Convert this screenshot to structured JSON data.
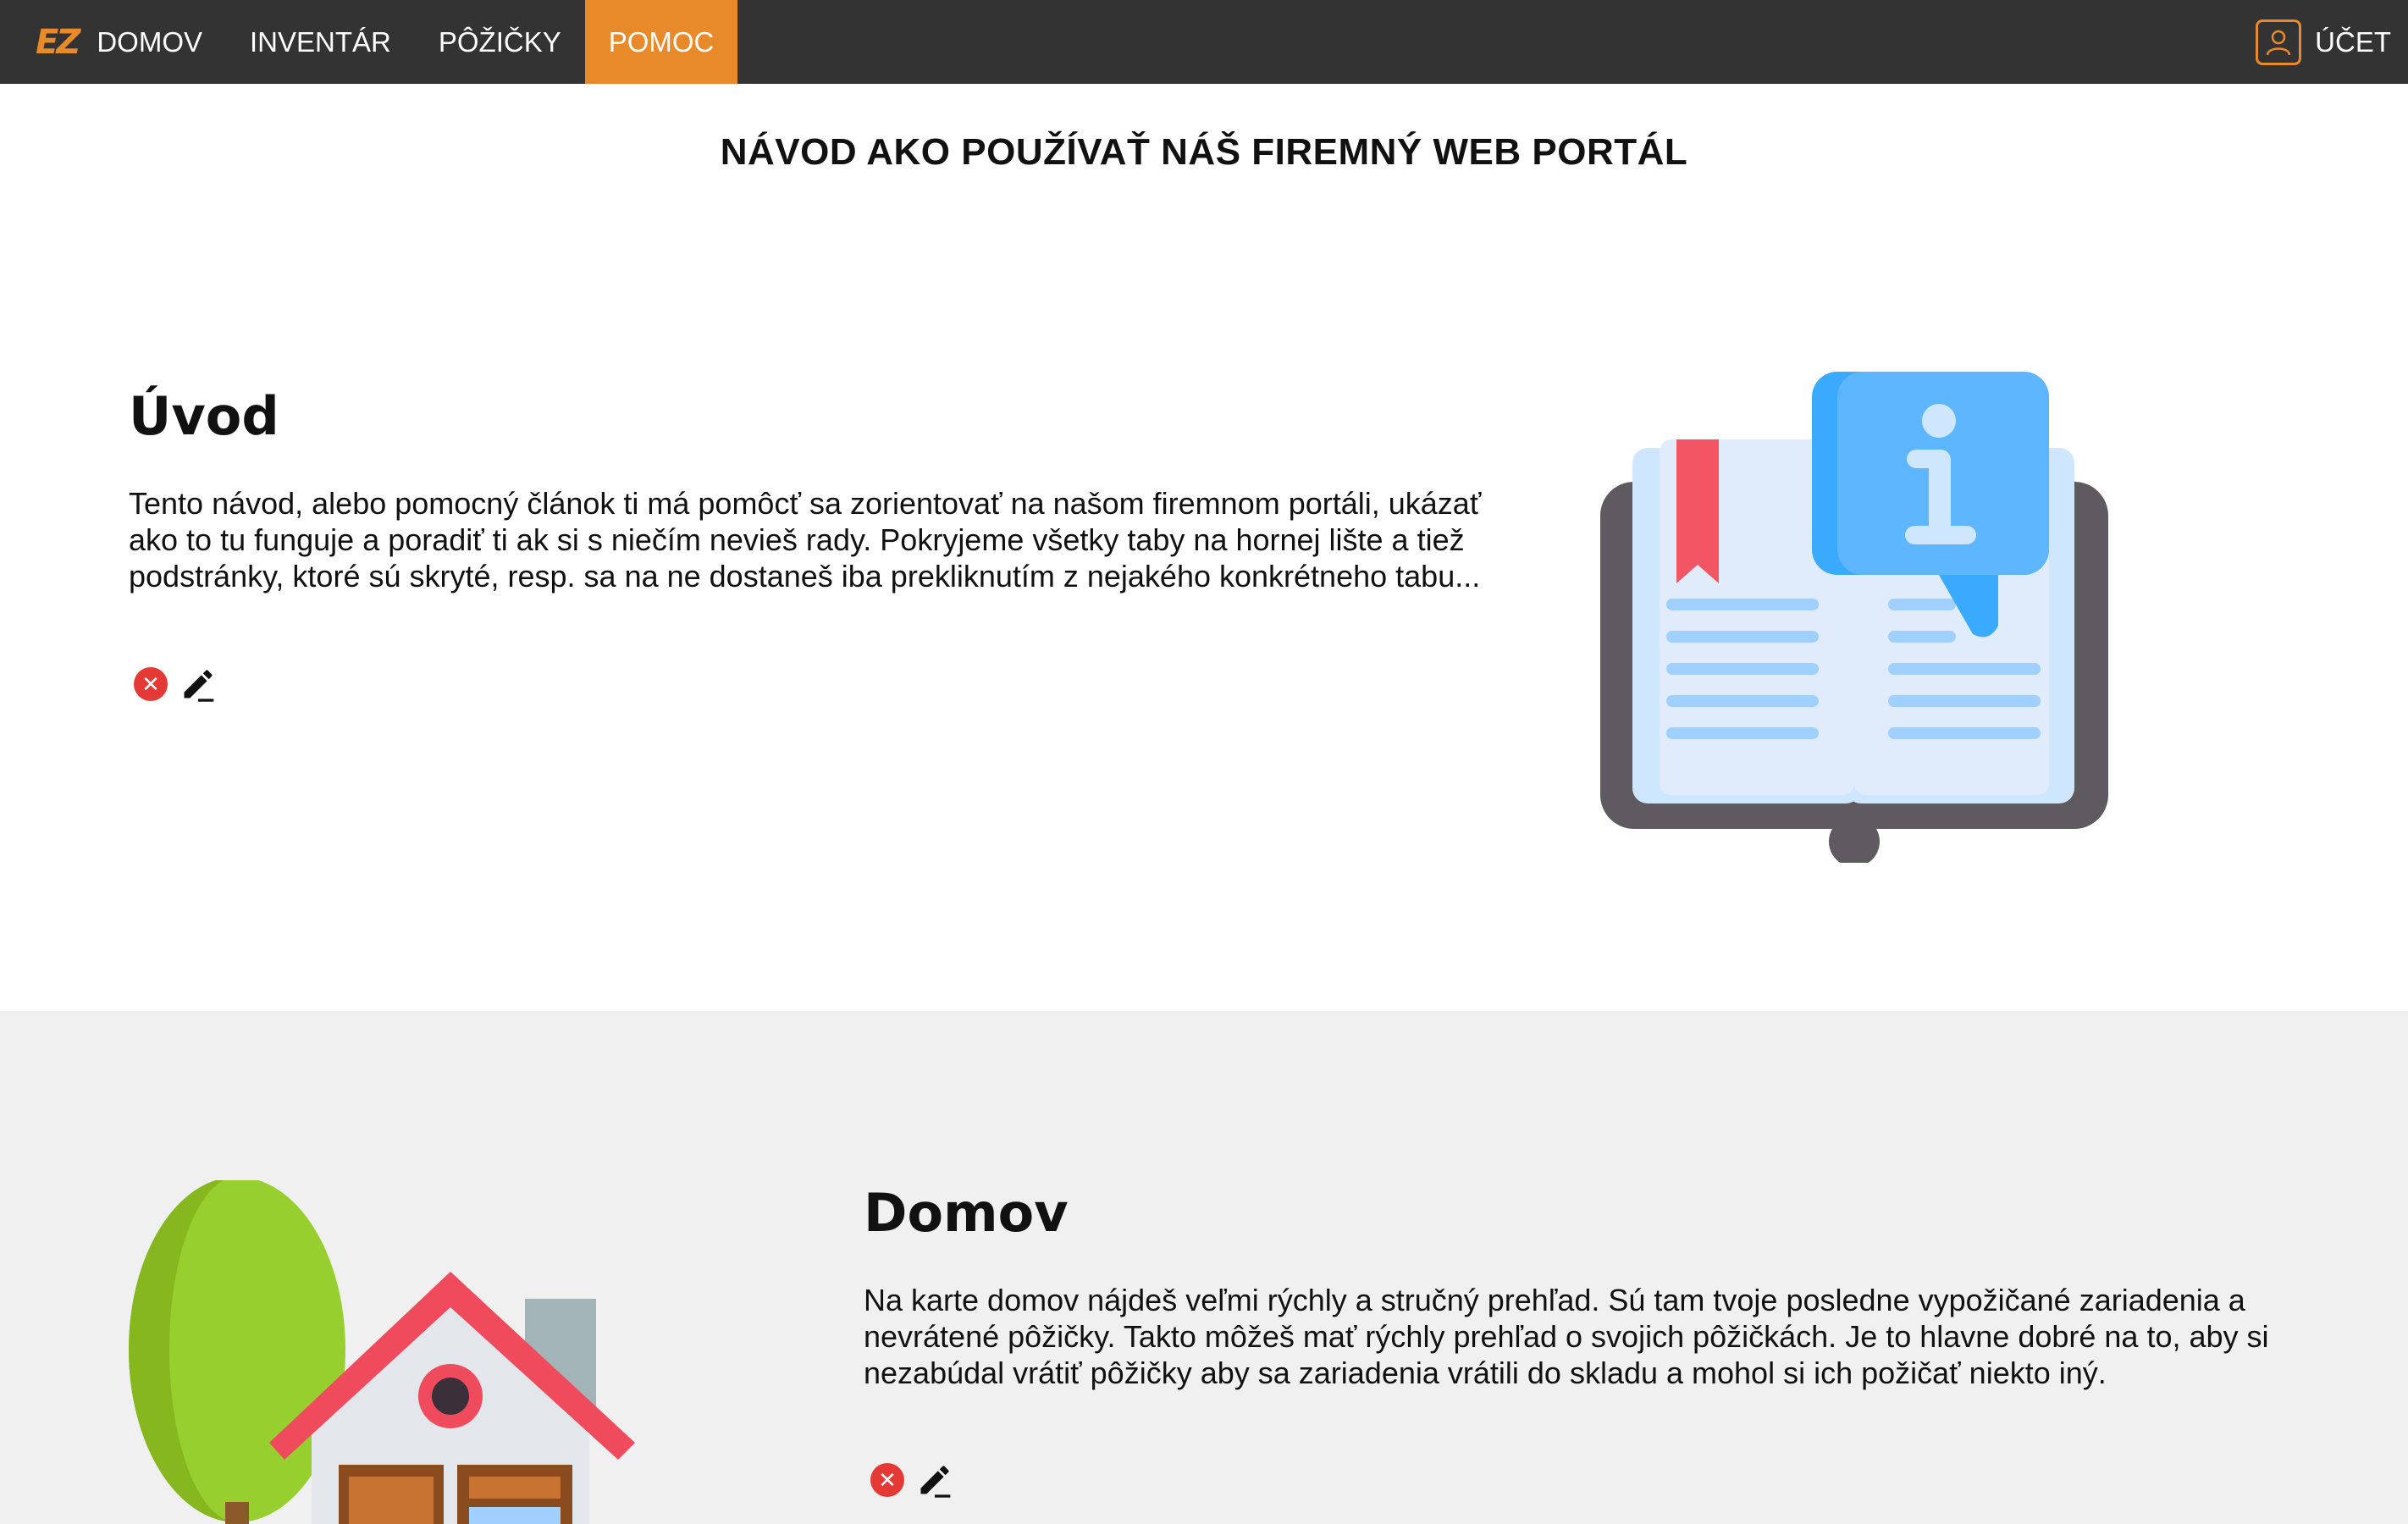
{
  "nav": {
    "logo": "EZ",
    "items": [
      {
        "label": "DOMOV"
      },
      {
        "label": "INVENTÁR"
      },
      {
        "label": "PÔŽIČKY"
      },
      {
        "label": "POMOC"
      }
    ],
    "active_item": "POMOC",
    "account_label": "ÚČET"
  },
  "page": {
    "title": "NÁVOD AKO POUŽÍVAŤ NÁŠ FIREMNÝ WEB PORTÁL"
  },
  "sections": [
    {
      "heading": "Úvod",
      "text": "Tento návod, alebo pomocný článok ti má pomôcť sa zorientovať na našom firemnom portáli, ukázať ako to tu funguje a poradiť ti ak si s niečím nevieš rady. Pokryjeme všetky taby na hornej lište a tiež podstránky, ktoré sú skryté, resp. sa na ne dostaneš iba prekliknutím z nejakého konkrétneho tabu...",
      "illustration": "book-info-icon"
    },
    {
      "heading": "Domov",
      "text": "Na karte domov nájdeš veľmi rýchly a stručný prehľad. Sú tam tvoje posledne vypožičané zariadenia a nevrátené pôžičky. Takto môžeš mať rýchly prehľad o svojich pôžičkách. Je to hlavne dobré na to, aby si nezabúdal vrátiť pôžičky aby sa zariadenia vrátili do skladu a mohol si ich požičať niekto iný.",
      "illustration": "house-icon"
    }
  ],
  "colors": {
    "nav_bg": "#333333",
    "accent": "#E8892A",
    "delete": "#E53935",
    "alt_section_bg": "#f0f0f0"
  },
  "icons": {
    "delete": "close-circle-icon",
    "edit": "pencil-icon",
    "account": "user-icon"
  }
}
